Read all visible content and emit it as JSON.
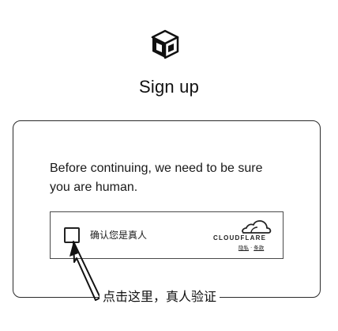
{
  "header": {
    "logo_icon": "cube-logo-icon",
    "title": "Sign up"
  },
  "challenge": {
    "prompt_line1": "Before continuing, we need to be sure",
    "prompt_line2": "you are human.",
    "widget": {
      "checkbox_checked": false,
      "label": "确认您是真人",
      "brand": "CLOUDFLARE",
      "brand_icon": "cloudflare-cloud-icon",
      "privacy_link": "隐私",
      "separator": "·",
      "terms_link": "条款"
    }
  },
  "annotation": {
    "text": "点击这里，真人验证",
    "arrow_icon": "arrow-pointer-icon"
  }
}
